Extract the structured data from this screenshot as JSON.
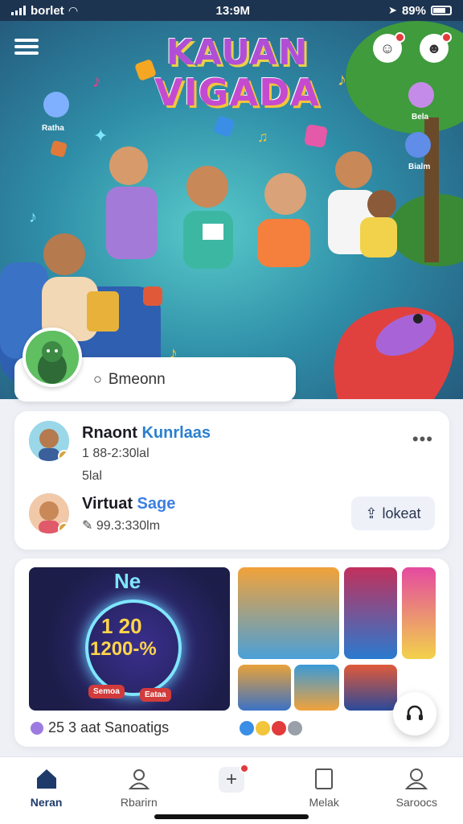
{
  "status_bar": {
    "carrier": "borlet",
    "time": "13:9M",
    "battery": "89%"
  },
  "hero": {
    "title_line1": "KAUAN",
    "title_line2": "VIGADA",
    "left_badge_label": "Ratha",
    "right_badge_label_top": "Bela",
    "right_badge_label_bottom": "Bialm"
  },
  "search": {
    "placeholder": "Bmeonn",
    "icon": "search-icon"
  },
  "recent": {
    "title_a": "Rnaont ",
    "title_a_highlight": "Kunrlaas",
    "sub_a1": "1  88-2:30lal",
    "sub_a2": "5lal",
    "more": "•••",
    "title_b": "Virtuat ",
    "title_b_highlight": "Sage",
    "sub_b": "99.3:330lm",
    "upload_label": "lokeat"
  },
  "media": {
    "promo_n1": "Ne",
    "promo_n2": "1  20",
    "promo_n3": "1200-%",
    "promo_tag1": "Semoa",
    "promo_tag2": "Eataa",
    "caption": "25 3  aat Sanoatigs"
  },
  "nav": [
    {
      "label": "Neran",
      "icon": "home-icon",
      "active": true
    },
    {
      "label": "Rbarirn",
      "icon": "profile-icon",
      "active": false
    },
    {
      "label": "",
      "icon": "plus-icon",
      "active": false
    },
    {
      "label": "Melak",
      "icon": "book-icon",
      "active": false
    },
    {
      "label": "Saroocs",
      "icon": "user-icon",
      "active": false
    }
  ],
  "colors": {
    "accent": "#2a7fd0",
    "badge_red": "#e23b3b",
    "status_bar": "#1d3450"
  }
}
